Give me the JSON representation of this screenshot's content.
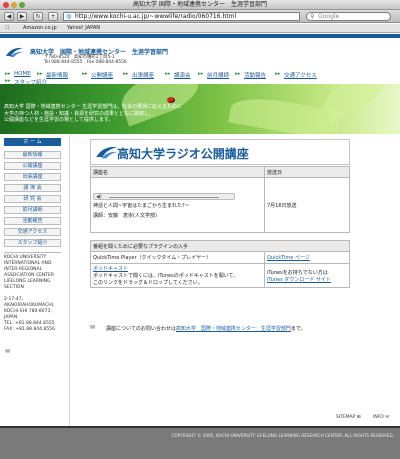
{
  "window": {
    "title": "高知大学 国際・地域連携センター　生涯学習部門"
  },
  "toolbar": {
    "back": "◀",
    "forward": "▶",
    "reload": "↻",
    "add": "+",
    "url": "http://www.kochi-u.ac.jp/~wwwlife/radio/060716.html",
    "search_placeholder": "Google"
  },
  "bookmarks": {
    "items": [
      "Amazon.co.jp",
      "Yahoo! JAPAN"
    ]
  },
  "header": {
    "org": "高知大学",
    "dept": "国際・地域連携センター　生涯学習部門",
    "address": "〒780-8520　高知市曙町2丁目5-1",
    "tel": "Tel 088-844-8555　Fax 088-844-8556"
  },
  "nav": {
    "items": [
      "HOME",
      "最新情報",
      "公開講座",
      "出張講座",
      "講演会",
      "前月講師",
      "活動報告",
      "交通アクセス",
      "スタッフ紹介"
    ]
  },
  "banner": {
    "line1": "高知大学 国際・地域連携センター 生涯学習部門は、社会の要請に応えるために",
    "line2": "大学の持つ人材・施設・知識・資源を研究の成果とともに開放し、",
    "line3": "公開講座などを生涯学習の場として提供します。"
  },
  "sidebar": {
    "heading": "ホ ー ム",
    "items": [
      "最新情報",
      "公開講座",
      "出張講座",
      "講 演 会",
      "研 究 会",
      "前月講師",
      "活動報告",
      "交通アクセス",
      "スタッフ紹介"
    ],
    "info": [
      "KOCHI UNIVERSITY",
      "INTERNATIONAL AND",
      "INTER-REGIONAL",
      "ASSOCIATION CENTER",
      "LIFELONG LEARNING",
      "SECTION",
      "",
      "2-17-47,",
      "AKAKURAHOKUMACHI,",
      "KOCHI-SHI 780-8073,",
      "JAPAN",
      "TEL: +81.88.844.8555",
      "FAX: +81.88.844.8556"
    ]
  },
  "main": {
    "title": "高知大学ラジオ公開講座",
    "col_title": "講座名",
    "col_date": "放送日",
    "lecture_title": "神話と人間~宇宙はたまごから生まれた?~",
    "lecture_speaker": "講師：安藤　恵崇(人文学部)",
    "broadcast_date": "7月16日放送",
    "plugin_heading": "番組を聞くために必要なプラグインの入手",
    "qt_name": "QuickTime Player（クイックタイム・プレイヤー）",
    "qt_link": "QuickTime ページ",
    "pod_name": "ポッドキャスト",
    "pod_desc1": "ポッドキャストで聞くには、iTunesのポッドキャストを開いて、",
    "pod_desc2": "このリンクをドラッグ＆ドロップしてください。",
    "itunes_desc": "iTunesをお持ちでない方は",
    "itunes_link": "iTunes ダウンロード サイト",
    "inquiry_prefix": "講座についてのお問い合わせは",
    "inquiry_link": "高知大学　国際・地域連携センター　生涯学習部門",
    "inquiry_suffix": "まで。"
  },
  "footer": {
    "sitemap": "SITEMAP",
    "info": "INFO",
    "copyright": "COPYRIGHT © 2005, KOCHI UNIVERSITY LIFELONG LEARNING RESEARCH CENTER.  ALL RIGHTS RESERVED."
  },
  "colors": {
    "brand": "#1a5d9c",
    "accent": "#2a9e3a"
  }
}
